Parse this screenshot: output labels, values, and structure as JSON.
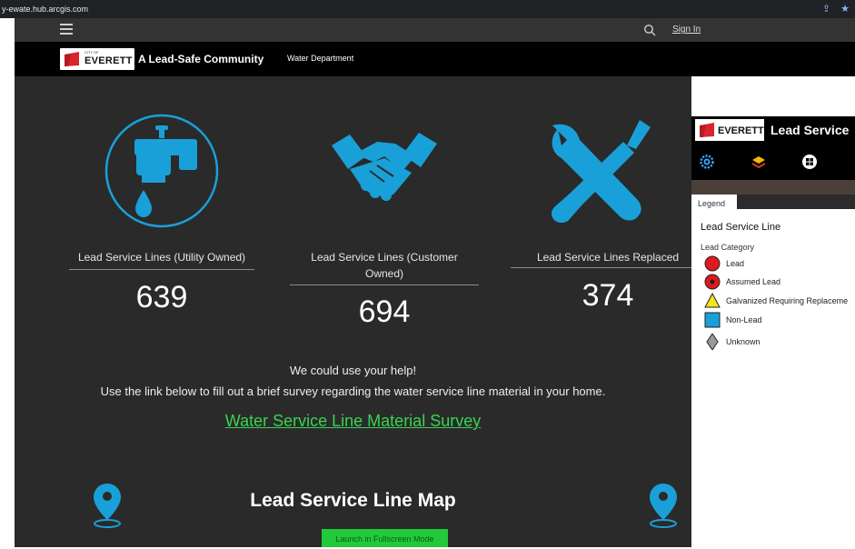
{
  "browser": {
    "url": "y-ewate.hub.arcgis.com"
  },
  "nav": {
    "signin": "Sign In"
  },
  "header": {
    "logo_wordmark": "EVERETT",
    "logo_cityof": "CITY OF",
    "title": "A Lead-Safe Community",
    "department": "Water Department"
  },
  "stats": [
    {
      "label": "Lead Service Lines (Utility Owned)",
      "value": "639",
      "icon": "faucet-icon"
    },
    {
      "label": "Lead Service Lines (Customer Owned)",
      "value": "694",
      "icon": "handshake-icon"
    },
    {
      "label": "Lead Service Lines Replaced",
      "value": "374",
      "icon": "tools-icon"
    }
  ],
  "help": {
    "line1": "We could use your help!",
    "line2": "Use the link below to fill out a brief survey regarding the water service line material in your home.",
    "survey_link": "Water Service Line Material Survey"
  },
  "map": {
    "title": "Lead Service Line Map",
    "launch_button": "Launch in Fullscreen Mode"
  },
  "panel": {
    "logo_wordmark": "EVERETT",
    "title": "Lead Service",
    "legend_tab": "Legend",
    "legend_title": "Lead Service Line",
    "legend_subtitle": "Lead Category",
    "legend_items": [
      {
        "label": "Lead",
        "symbol": "red-circle",
        "color": "#e0191c"
      },
      {
        "label": "Assumed Lead",
        "symbol": "red-circle-dot",
        "color": "#e0191c"
      },
      {
        "label": "Galvanized Requiring Replaceme",
        "symbol": "yellow-triangle",
        "color": "#f5e51b"
      },
      {
        "label": "Non-Lead",
        "symbol": "blue-square",
        "color": "#1a9fd9"
      },
      {
        "label": "Unknown",
        "symbol": "gray-diamond",
        "color": "#9a9a9a"
      }
    ]
  },
  "colors": {
    "accent": "#1aa0d8",
    "link": "#39d353",
    "button": "#22c93a"
  }
}
